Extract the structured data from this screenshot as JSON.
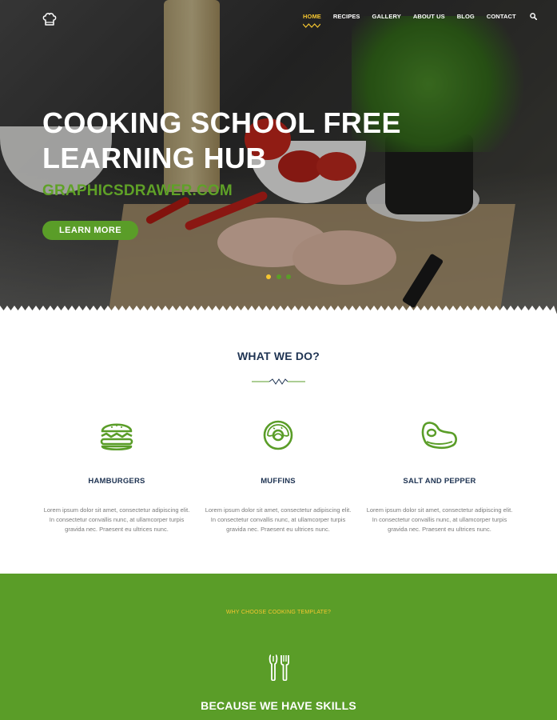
{
  "nav": {
    "items": [
      {
        "label": "HOME",
        "active": true
      },
      {
        "label": "RECIPES",
        "active": false
      },
      {
        "label": "GALLERY",
        "active": false
      },
      {
        "label": "ABOUT US",
        "active": false
      },
      {
        "label": "BLOG",
        "active": false
      },
      {
        "label": "CONTACT",
        "active": false
      }
    ],
    "logo_icon": "chef-hat-icon",
    "search_icon": "search-icon"
  },
  "hero": {
    "title": "COOKING SCHOOL FREE LEARNING HUB",
    "subtitle": "GRAPHICSDRAWER.COM",
    "button_label": "LEARN MORE",
    "slides": {
      "count": 3,
      "active_index": 0
    }
  },
  "what_we_do": {
    "title": "WHAT WE DO?",
    "features": [
      {
        "icon": "burger-icon",
        "title": "HAMBURGERS",
        "text": "Lorem ipsum dolor sit amet, consectetur adipiscing elit. In consectetur convallis nunc, at ullamcorper turpis gravida nec. Praesent eu ultrices nunc."
      },
      {
        "icon": "donut-icon",
        "title": "MUFFINS",
        "text": "Lorem ipsum dolor sit amet, consectetur adipiscing elit. In consectetur convallis nunc, at ullamcorper turpis gravida nec. Praesent eu ultrices nunc."
      },
      {
        "icon": "steak-icon",
        "title": "SALT AND PEPPER",
        "text": "Lorem ipsum dolor sit amet, consectetur adipiscing elit. In consectetur convallis nunc, at ullamcorper turpis gravida nec. Praesent eu ultrices nunc."
      }
    ]
  },
  "why": {
    "tagline": "WHY CHOOSE COOKING TEMPLATE?",
    "icon": "fork-knife-icon",
    "title": "BECAUSE WE HAVE SKILLS"
  },
  "colors": {
    "accent_green": "#5a9d28",
    "accent_yellow": "#f5c630",
    "heading_navy": "#1e3352",
    "body_gray": "#7a7a7a"
  }
}
